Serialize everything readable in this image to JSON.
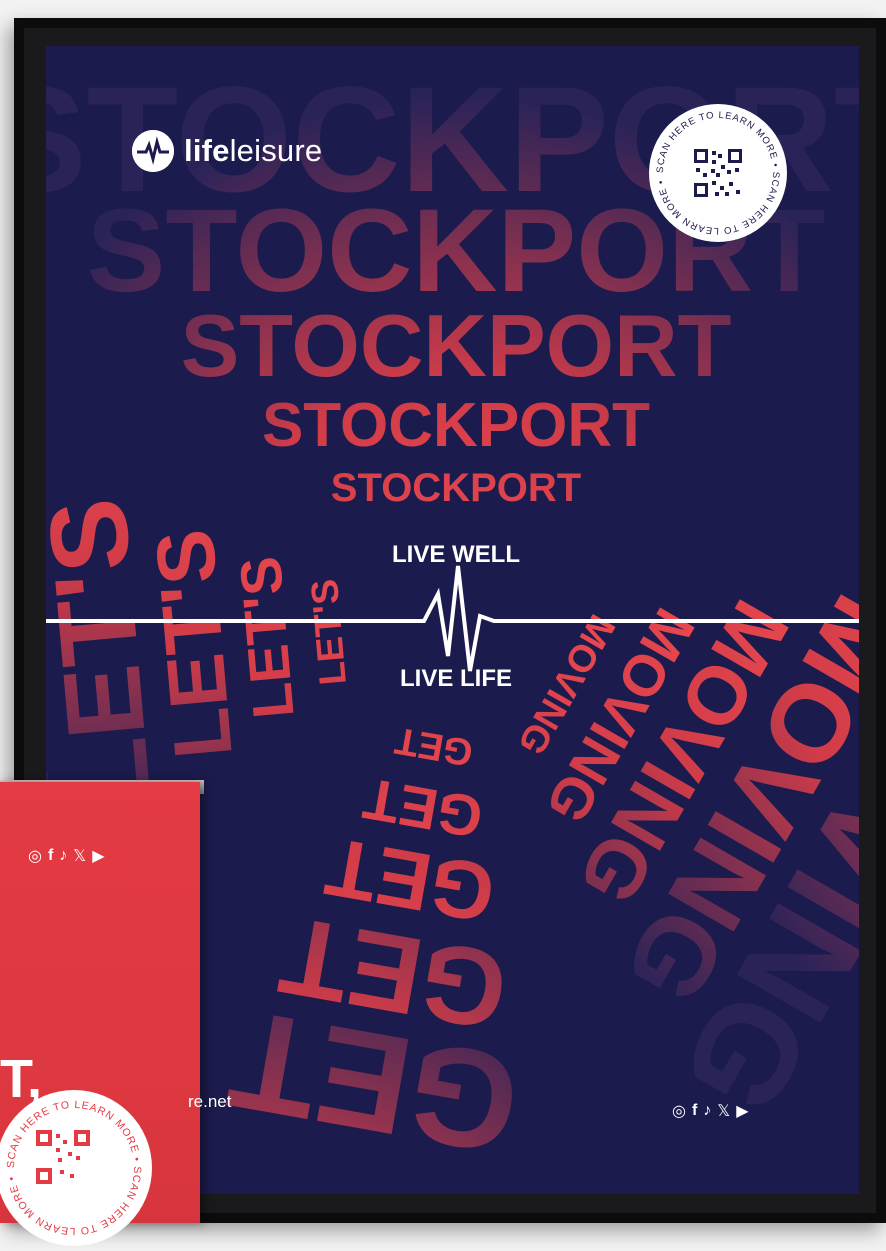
{
  "brand": {
    "name_bold": "life",
    "name_light": "leisure"
  },
  "qr": {
    "caption": "SCAN HERE TO LEARN MORE"
  },
  "poster": {
    "town_word": "STOCKPORT",
    "slogan_top": "LIVE WELL",
    "slogan_bottom": "LIVE LIFE",
    "rings": [
      {
        "left": "LET'S",
        "mid": "GET",
        "right": "MOVING"
      }
    ]
  },
  "banner": {
    "heading": "T,",
    "url_suffix": "re.net"
  },
  "social_icons": [
    "instagram-icon",
    "facebook-icon",
    "tiktok-icon",
    "x-icon",
    "youtube-icon"
  ],
  "colors": {
    "navy": "#1c1b4d",
    "red": "#e8474d",
    "white": "#ffffff"
  }
}
